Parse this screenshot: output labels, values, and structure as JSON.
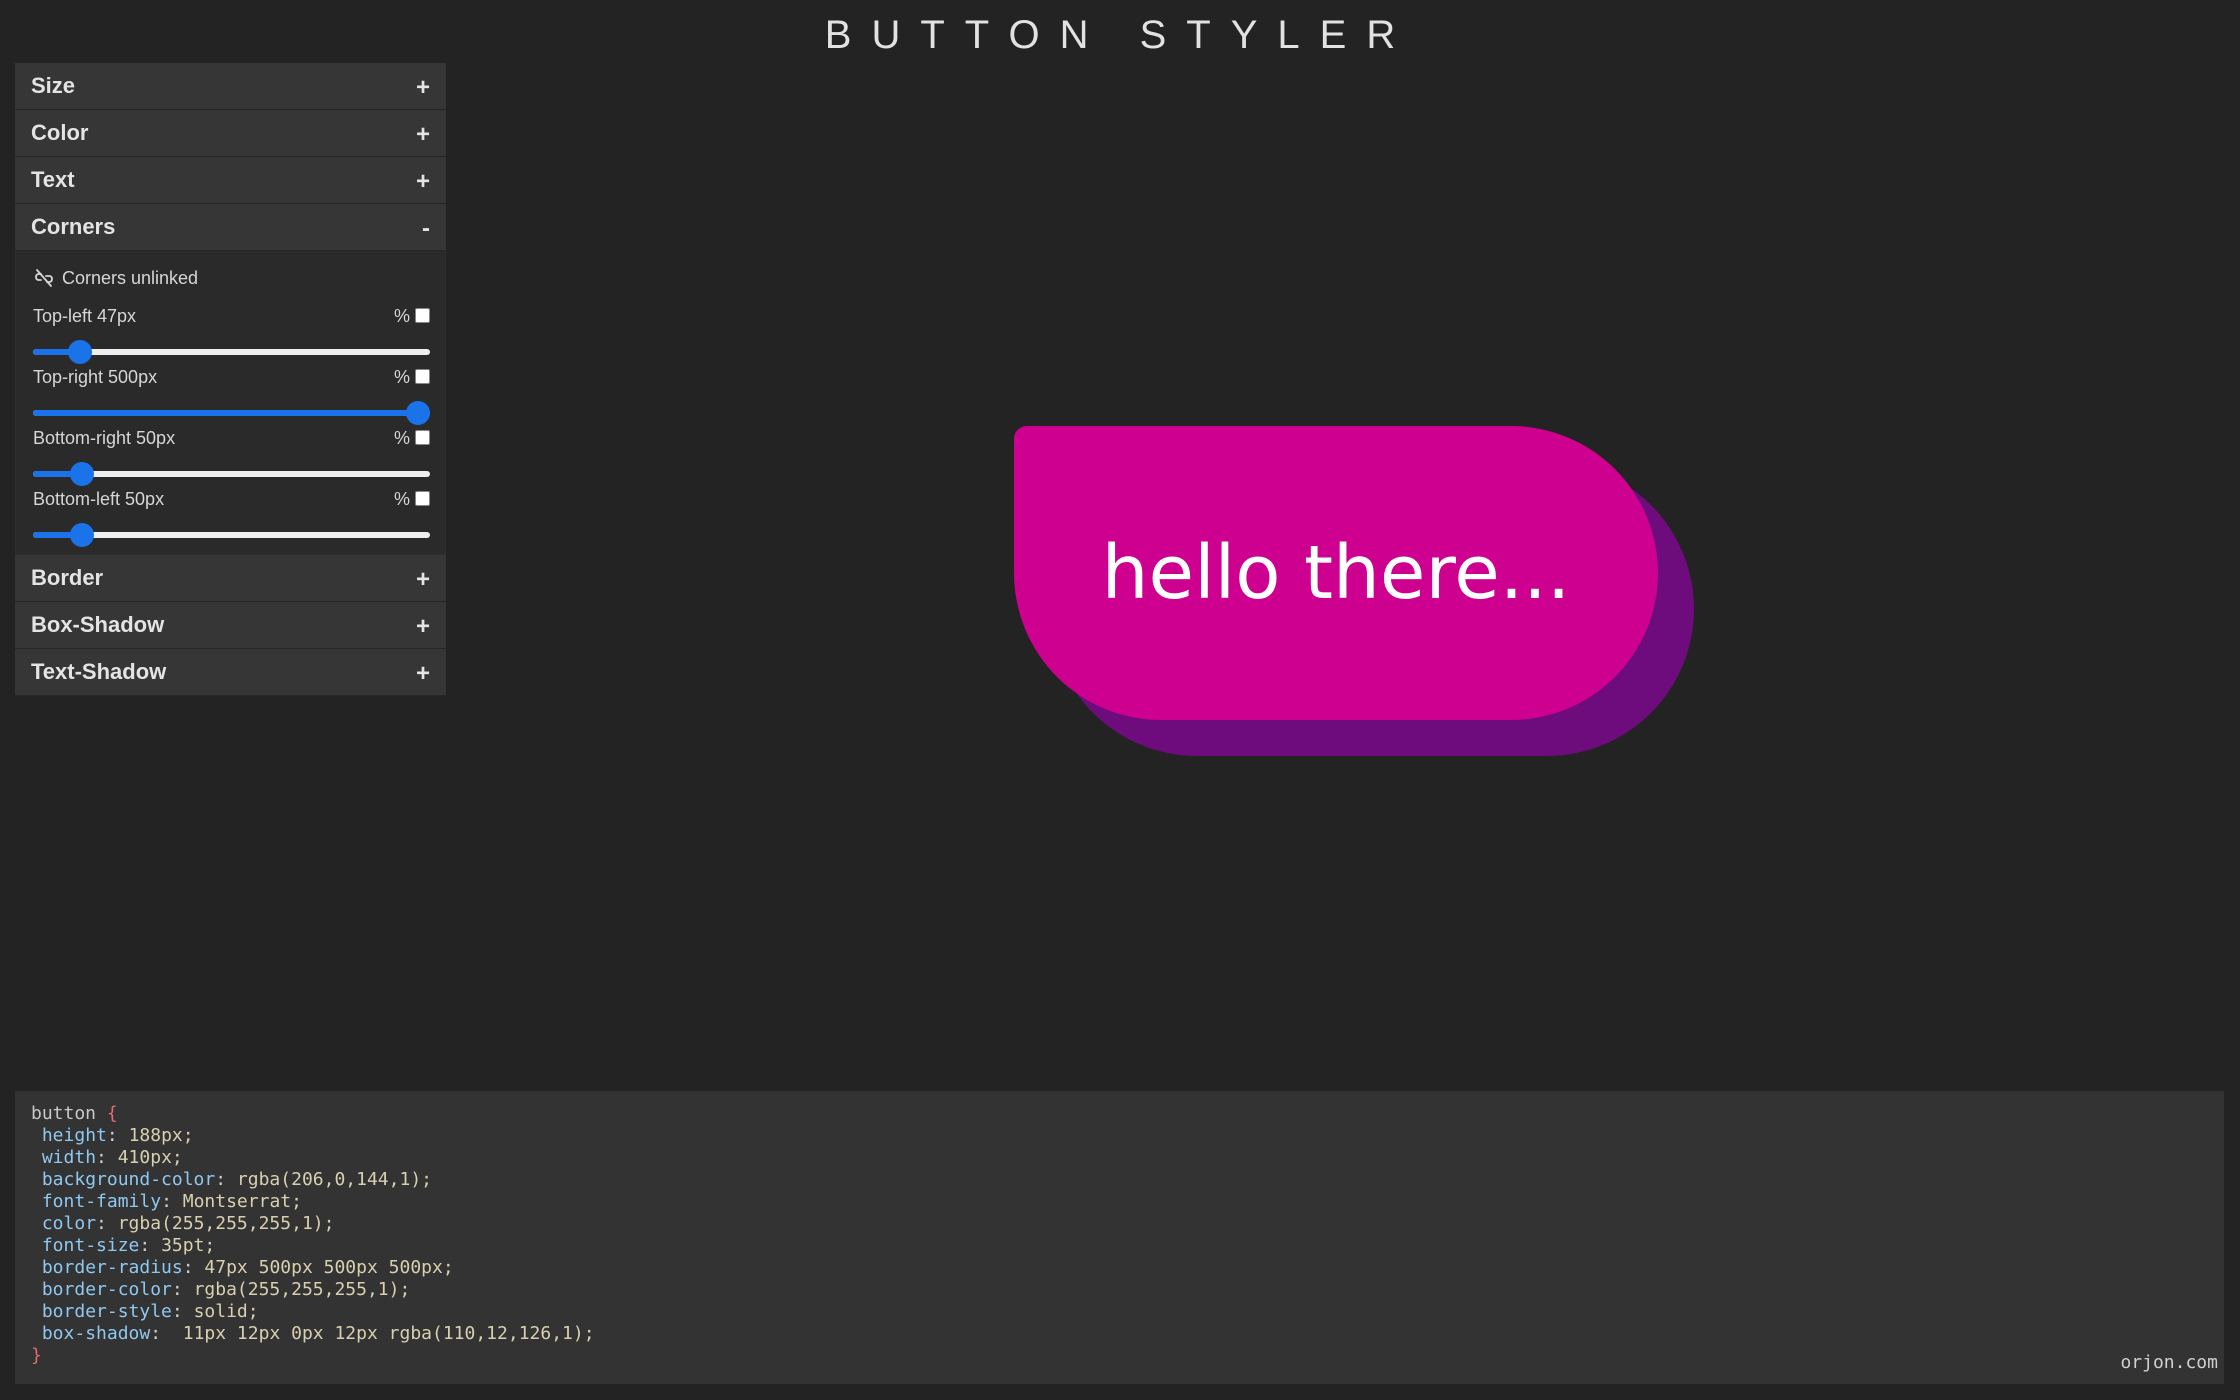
{
  "app_title": "BUTTON STYLER",
  "sections": {
    "size": {
      "label": "Size",
      "toggle": "+"
    },
    "color": {
      "label": "Color",
      "toggle": "+"
    },
    "text": {
      "label": "Text",
      "toggle": "+"
    },
    "corners": {
      "label": "Corners",
      "toggle": "-"
    },
    "border": {
      "label": "Border",
      "toggle": "+"
    },
    "box_shadow": {
      "label": "Box-Shadow",
      "toggle": "+"
    },
    "text_shadow": {
      "label": "Text-Shadow",
      "toggle": "+"
    }
  },
  "corners": {
    "link_label": "Corners unlinked",
    "link_icon": "unlink-icon",
    "percent_symbol": "%",
    "slider_color": "#1a73e8",
    "items": [
      {
        "label": "Top-left 47px",
        "value": 47,
        "min": 0,
        "max": 500,
        "percent_checked": false
      },
      {
        "label": "Top-right 500px",
        "value": 500,
        "min": 0,
        "max": 500,
        "percent_checked": false
      },
      {
        "label": "Bottom-right 50px",
        "value": 50,
        "min": 0,
        "max": 500,
        "percent_checked": false
      },
      {
        "label": "Bottom-left 50px",
        "value": 50,
        "min": 0,
        "max": 500,
        "percent_checked": false
      }
    ]
  },
  "preview": {
    "text": "hello there...",
    "background_color": "#ce0090",
    "shadow_color": "#6e0c7e",
    "text_color": "#ffffff"
  },
  "css_output": {
    "selector": "button",
    "open_brace": "{",
    "close_brace": "}",
    "declarations": [
      {
        "prop": "height",
        "value": "188px;"
      },
      {
        "prop": "width",
        "value": "410px;"
      },
      {
        "prop": "background-color",
        "value": "rgba(206,0,144,1);"
      },
      {
        "prop": "font-family",
        "value": "Montserrat;"
      },
      {
        "prop": "color",
        "value": "rgba(255,255,255,1);"
      },
      {
        "prop": "font-size",
        "value": "35pt;"
      },
      {
        "prop": "border-radius",
        "value": "47px 500px 500px 500px;"
      },
      {
        "prop": "border-color",
        "value": "rgba(255,255,255,1);"
      },
      {
        "prop": "border-style",
        "value": "solid;"
      },
      {
        "prop": "box-shadow",
        "value": " 11px 12px 0px 12px rgba(110,12,126,1);"
      }
    ]
  },
  "footer": "orjon.com"
}
